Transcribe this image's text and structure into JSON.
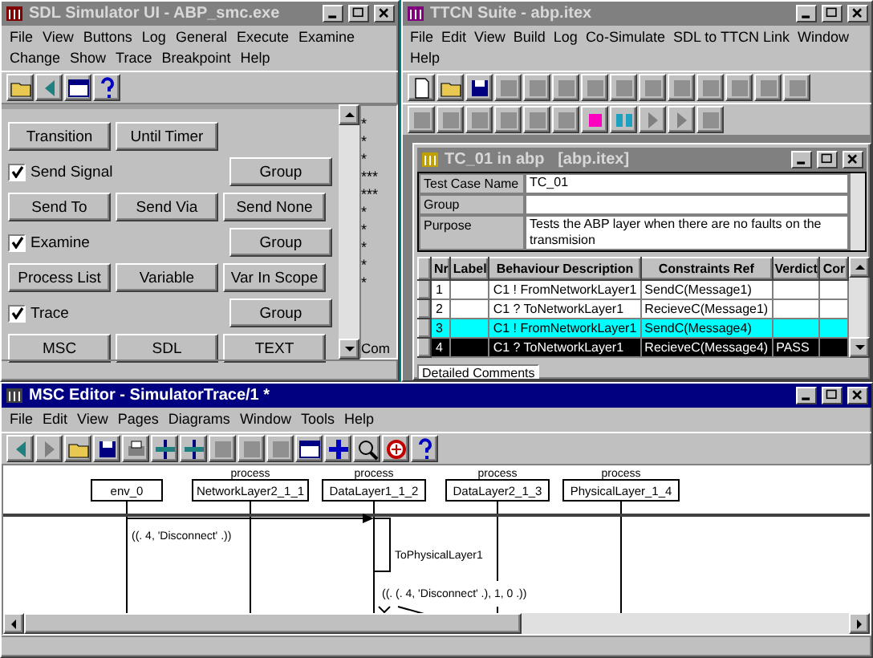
{
  "simulator": {
    "title": "SDL Simulator UI - ABP_smc.exe",
    "active": false,
    "menu": [
      "File",
      "View",
      "Buttons",
      "Log",
      "General",
      "Execute",
      "Examine",
      "Change",
      "Show",
      "Trace",
      "Breakpoint",
      "Help"
    ],
    "rows": [
      {
        "kind": "buttons",
        "buttons": [
          "Transition",
          "Until Timer"
        ]
      },
      {
        "kind": "check",
        "label": "Send Signal",
        "checked": true,
        "button": "Group"
      },
      {
        "kind": "buttons",
        "buttons": [
          "Send To",
          "Send Via",
          "Send None"
        ]
      },
      {
        "kind": "check",
        "label": "Examine",
        "checked": true,
        "button": "Group"
      },
      {
        "kind": "buttons",
        "buttons": [
          "Process List",
          "Variable",
          "Var In Scope"
        ]
      },
      {
        "kind": "check",
        "label": "Trace",
        "checked": true,
        "button": "Group"
      },
      {
        "kind": "buttons",
        "buttons": [
          "MSC",
          "SDL",
          "TEXT"
        ]
      }
    ],
    "trace_marks": "*\n*\n*\n***\n***\n*\n*\n*\n*\n*",
    "trace_footer": "Com"
  },
  "ttcn": {
    "title": "TTCN Suite - abp.itex",
    "active": false,
    "menu": [
      "File",
      "Edit",
      "View",
      "Build",
      "Log",
      "Co-Simulate",
      "SDL to TTCN Link",
      "Window",
      "Help"
    ],
    "child": {
      "title": "TC_01 in abp",
      "file": "[abp.itex]",
      "active": false,
      "fields": [
        {
          "label": "Test Case Name",
          "value": "TC_01"
        },
        {
          "label": "Group"
        },
        {
          "label": "Purpose",
          "value": "Tests the ABP layer when there are no faults on the transmision"
        }
      ],
      "columns": [
        "Nr",
        "Label",
        "Behaviour Description",
        "Constraints Ref",
        "Verdict",
        "Cor"
      ],
      "rows": [
        {
          "nr": "1",
          "behaviour": "C1 ! FromNetworkLayer1",
          "constraints": "SendC(Message1)",
          "selected": false,
          "current": false
        },
        {
          "nr": "2",
          "behaviour": "C1 ? ToNetworkLayer1",
          "constraints": "RecieveC(Message1)",
          "selected": false,
          "current": false
        },
        {
          "nr": "3",
          "behaviour": "C1 ! FromNetworkLayer1",
          "constraints": "SendC(Message4)",
          "selected": true,
          "current": false
        },
        {
          "nr": "4",
          "behaviour": "C1 ? ToNetworkLayer1",
          "constraints": "RecieveC(Message4)",
          "verdict": "PASS",
          "selected": false,
          "current": true
        }
      ],
      "comments_label": "Detailed Comments"
    }
  },
  "msc": {
    "title": "MSC Editor - SimulatorTrace/1 *",
    "active": true,
    "menu": [
      "File",
      "Edit",
      "View",
      "Pages",
      "Diagrams",
      "Window",
      "Tools",
      "Help"
    ],
    "instances": [
      {
        "name": "env_0"
      },
      {
        "kind": "process",
        "name": "NetworkLayer2_1_1"
      },
      {
        "kind": "process",
        "name": "DataLayer1_1_2"
      },
      {
        "kind": "process",
        "name": "DataLayer2_1_3"
      },
      {
        "kind": "process",
        "name": "PhysicalLayer_1_4"
      }
    ],
    "messages": [
      {
        "label": "((. 4, 'Disconnect' .))"
      },
      {
        "label": "ToPhysicalLayer1"
      },
      {
        "label": "((. (. 4, 'Disconnect' .), 1, 0 .))"
      }
    ]
  }
}
